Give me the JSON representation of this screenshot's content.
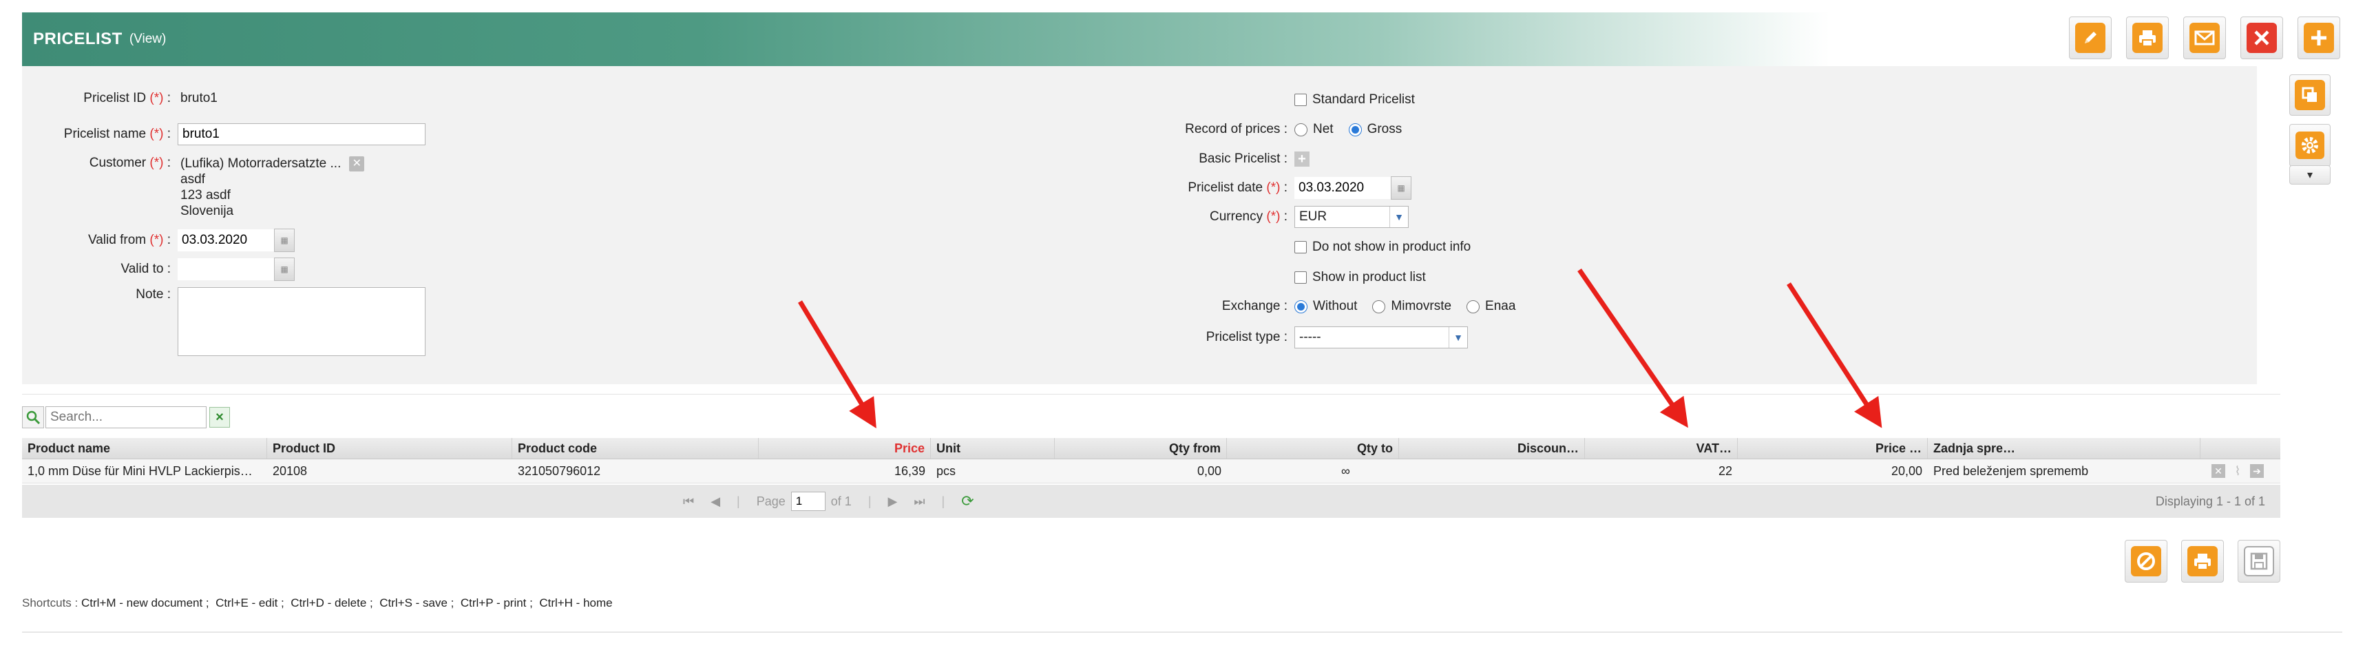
{
  "header": {
    "title": "PRICELIST",
    "subtitle": "(View)"
  },
  "toolbar": {
    "edit_icon": "pencil-icon",
    "print_icon": "printer-icon",
    "email_icon": "envelope-icon",
    "delete_icon": "close-icon",
    "add_icon": "plus-icon"
  },
  "side": {
    "copy_icon": "copy-icon",
    "settings_icon": "gear-icon",
    "dropdown": "▾"
  },
  "form": {
    "pricelist_id": {
      "label": "Pricelist ID",
      "req": "(*)",
      "colon": ":",
      "value": "bruto1"
    },
    "pricelist_name": {
      "label": "Pricelist name",
      "req": "(*)",
      "colon": ":",
      "value": "bruto1"
    },
    "customer": {
      "label": "Customer",
      "req": "(*)",
      "colon": ":",
      "line1": "(Lufika) Motorradersatzte ...",
      "line2": "asdf",
      "line3": "123 asdf",
      "line4": "Slovenija"
    },
    "valid_from": {
      "label": "Valid from",
      "req": "(*)",
      "colon": ":",
      "value": "03.03.2020"
    },
    "valid_to": {
      "label": "Valid to",
      "colon": ":",
      "value": ""
    },
    "note": {
      "label": "Note",
      "colon": ":",
      "value": ""
    },
    "standard_pricelist": {
      "label": "Standard Pricelist",
      "checked": false
    },
    "record_of_prices": {
      "label": "Record of prices",
      "colon": ":",
      "opt_net": "Net",
      "opt_gross": "Gross",
      "selected": "Gross"
    },
    "basic_pricelist": {
      "label": "Basic Pricelist",
      "colon": ":"
    },
    "pricelist_date": {
      "label": "Pricelist date",
      "req": "(*)",
      "colon": ":",
      "value": "03.03.2020"
    },
    "currency": {
      "label": "Currency",
      "req": "(*)",
      "colon": ":",
      "value": "EUR"
    },
    "no_show_product_info": {
      "label": "Do not show in product info",
      "checked": false
    },
    "show_product_list": {
      "label": "Show in product list",
      "checked": false
    },
    "exchange": {
      "label": "Exchange",
      "colon": ":",
      "opt1": "Without",
      "opt2": "Mimovrste",
      "opt3": "Enaa",
      "selected": "Without"
    },
    "pricelist_type": {
      "label": "Pricelist type",
      "colon": ":",
      "value": "-----"
    }
  },
  "search": {
    "placeholder": "Search...",
    "clear": "×"
  },
  "grid": {
    "columns": [
      "Product name",
      "Product ID",
      "Product code",
      "Price",
      "Unit",
      "Qty from",
      "Qty to",
      "Discoun…",
      "VAT…",
      "Price …",
      "Zadnja spre…"
    ],
    "rows": [
      {
        "product_name": "1,0 mm Düse für Mini HVLP Lackierpis…",
        "product_id": "20108",
        "product_code": "321050796012",
        "price": "16,39",
        "unit": "pcs",
        "qty_from": "0,00",
        "qty_to": "∞",
        "discount": "",
        "vat": "22",
        "price2": "20,00",
        "zadnja": "Pred beleženjem sprememb"
      }
    ]
  },
  "pager": {
    "page_label": "Page",
    "page_value": "1",
    "of_label": "of 1",
    "displaying": "Displaying 1 - 1 of 1"
  },
  "shortcuts": {
    "prefix": "Shortcuts :",
    "items": [
      "Ctrl+M - new document ;",
      "Ctrl+E - edit ;",
      "Ctrl+D - delete ;",
      "Ctrl+S - save ;",
      "Ctrl+P - print ;",
      "Ctrl+H - home"
    ]
  },
  "colors": {
    "header_green": "#3f8c76",
    "orange": "#f39a1e",
    "red": "#e53b2c",
    "annotation_red": "#e8201a"
  }
}
